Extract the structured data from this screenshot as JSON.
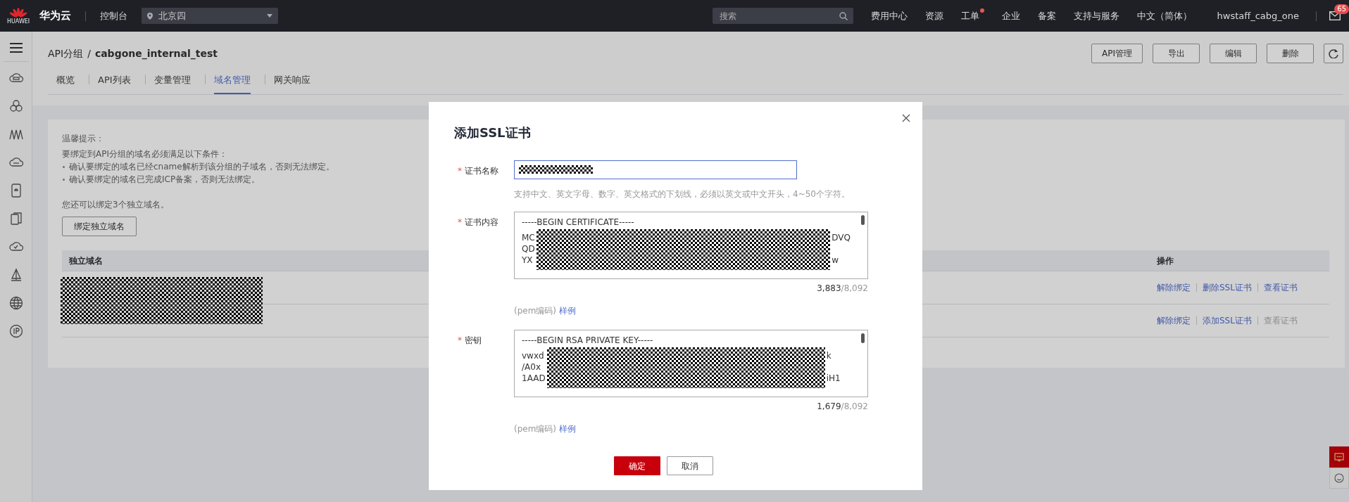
{
  "topbar": {
    "logo_caption": "HUAWEI",
    "brand": "华为云",
    "console": "控制台",
    "region": "北京四",
    "search": {
      "placeholder": "搜索"
    },
    "links": [
      {
        "label": "费用中心",
        "dot": false
      },
      {
        "label": "资源",
        "dot": false
      },
      {
        "label": "工单",
        "dot": true
      },
      {
        "label": "企业",
        "dot": false
      },
      {
        "label": "备案",
        "dot": false
      },
      {
        "label": "支持与服务",
        "dot": false
      },
      {
        "label": "中文（简体）",
        "dot": false
      }
    ],
    "user": "hwstaff_cabg_one",
    "mail_badge": "65"
  },
  "breadcrumb": {
    "parent": "API分组",
    "separator": "/",
    "current": "cabgone_internal_test"
  },
  "actions": [
    "API管理",
    "导出",
    "编辑",
    "删除"
  ],
  "tabs": [
    {
      "label": "概览",
      "selected": false
    },
    {
      "label": "API列表",
      "selected": false
    },
    {
      "label": "变量管理",
      "selected": false
    },
    {
      "label": "域名管理",
      "selected": true
    },
    {
      "label": "网关响应",
      "selected": false
    }
  ],
  "notice": {
    "title": "温馨提示：",
    "intro": "要绑定到API分组的域名必须满足以下条件：",
    "bullets": [
      "确认要绑定的域名已经cname解析到该分组的子域名，否则无法绑定。",
      "确认要绑定的域名已完成ICP备案，否则无法绑定。"
    ],
    "remaining": "您还可以绑定3个独立域名。"
  },
  "bind_button": "绑定独立域名",
  "table": {
    "columns": [
      "独立域名",
      "操作"
    ],
    "rows": [
      {
        "actions": [
          {
            "label": "解除绑定",
            "disabled": false
          },
          {
            "label": "删除SSL证书",
            "disabled": false
          },
          {
            "label": "查看证书",
            "disabled": false
          }
        ]
      },
      {
        "actions": [
          {
            "label": "解除绑定",
            "disabled": false
          },
          {
            "label": "添加SSL证书",
            "disabled": false
          },
          {
            "label": "查看证书",
            "disabled": true
          }
        ]
      }
    ]
  },
  "dialog": {
    "title": "添加SSL证书",
    "fields": [
      {
        "kind": "input",
        "label": "证书名称",
        "required_mark": "*",
        "hint": "支持中文、英文字母、数字、英文格式的下划线，必须以英文或中文开头，4~50个字符。"
      },
      {
        "kind": "textarea",
        "label": "证书内容",
        "required_mark": "*",
        "first_line": "-----BEGIN CERTIFICATE-----",
        "lines": [
          {
            "start": "MC",
            "end": "DVQ"
          },
          {
            "start": "QD"
          },
          {
            "start": "YX",
            "end": "w"
          }
        ],
        "count": "3,883",
        "limit": "/8,092",
        "format": "(pem编码)",
        "example_link": "样例"
      },
      {
        "kind": "textarea",
        "label": "密钥",
        "required_mark": "*",
        "first_line": "-----BEGIN RSA PRIVATE KEY-----",
        "lines": [
          {
            "start": "vwxd",
            "end": "k"
          },
          {
            "start": "/A0x"
          },
          {
            "start": "1AAD",
            "end": "iH1"
          }
        ],
        "count": "1,679",
        "limit": "/8,092",
        "format": "(pem编码)",
        "example_link": "样例"
      }
    ],
    "buttons": [
      {
        "label": "确定",
        "primary": true
      },
      {
        "label": "取消",
        "primary": false
      }
    ]
  }
}
